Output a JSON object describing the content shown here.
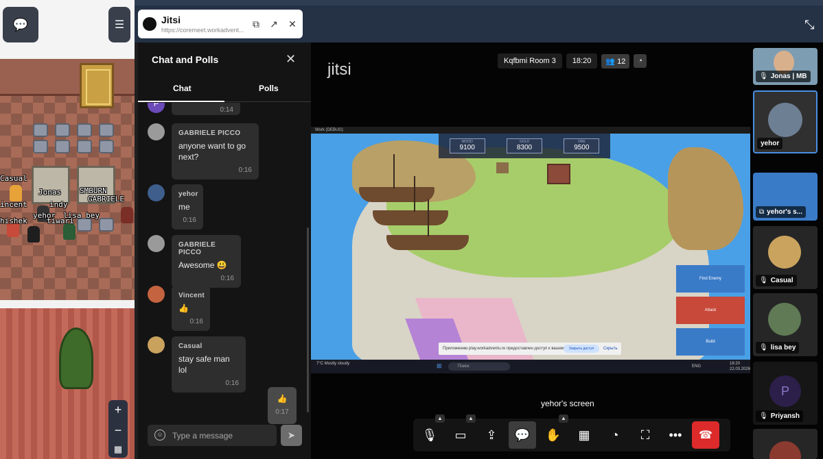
{
  "popup": {
    "title": "Jitsi",
    "url": "https://coremeet.workadvent..."
  },
  "map": {
    "name_tags": [
      "Casual",
      "Jonas",
      "SMBURN",
      "GABRIELE",
      "incent",
      "indy",
      "yehor",
      "lisa bey",
      "hishek",
      "tiwari"
    ],
    "zoom_in": "+",
    "zoom_out": "−"
  },
  "chat": {
    "title": "Chat and Polls",
    "tabs": [
      "Chat",
      "Polls"
    ],
    "partial_msg": {
      "avatar_letter": "P",
      "time": "0:14"
    },
    "messages": [
      {
        "sender": "GABRIELE PICCO",
        "text": "anyone want to go next?",
        "time": "0:16"
      },
      {
        "sender": "yehor",
        "text": "me",
        "time": "0:16"
      },
      {
        "sender": "GABRIELE PICCO",
        "text": "Awesome 😃",
        "time": "0:16"
      },
      {
        "sender": "Vincent",
        "text": "👍",
        "time": "0:16"
      },
      {
        "sender": "Casual",
        "text": "stay safe man lol",
        "time": "0:16"
      }
    ],
    "own_message": {
      "text": "👍",
      "time": "0:17"
    },
    "input_placeholder": "Type a message"
  },
  "meeting": {
    "logo": "jitsi",
    "room_name": "Kqfbmi Room 3",
    "duration": "18:20",
    "participant_count": "12",
    "screen_label": "yehor's screen"
  },
  "shared_screen": {
    "window_title": "Work (DEBUG)",
    "resources": [
      {
        "label": "WOOD",
        "value": "9100"
      },
      {
        "label": "GOLD",
        "value": "8300"
      },
      {
        "label": "ORE",
        "value": "9500"
      }
    ],
    "buttons": [
      "Find Enemy",
      "Attack",
      "Build"
    ],
    "notice_text": "Приложению play.workadventu.re предоставлен доступ к вашему экрану",
    "notice_button": "Закрыть доступ",
    "notice_link": "Скрыть",
    "weather": "7°C Mostly cloudy",
    "search": "Поиск",
    "lang": "ENG",
    "clock": "18:20 22.03.2026"
  },
  "participants": [
    {
      "name": "Jonas | MB"
    },
    {
      "name": "yehor"
    },
    {
      "name": "yehor's s..."
    },
    {
      "name": "Casual"
    },
    {
      "name": "lisa bey"
    },
    {
      "name": "Priyansh",
      "initial": "P"
    }
  ],
  "colors": {
    "hangup": "#dd2a2a",
    "selected_tile": "#4a90e2",
    "attack_button": "#c8483a",
    "action_button": "#3a7bc8"
  }
}
